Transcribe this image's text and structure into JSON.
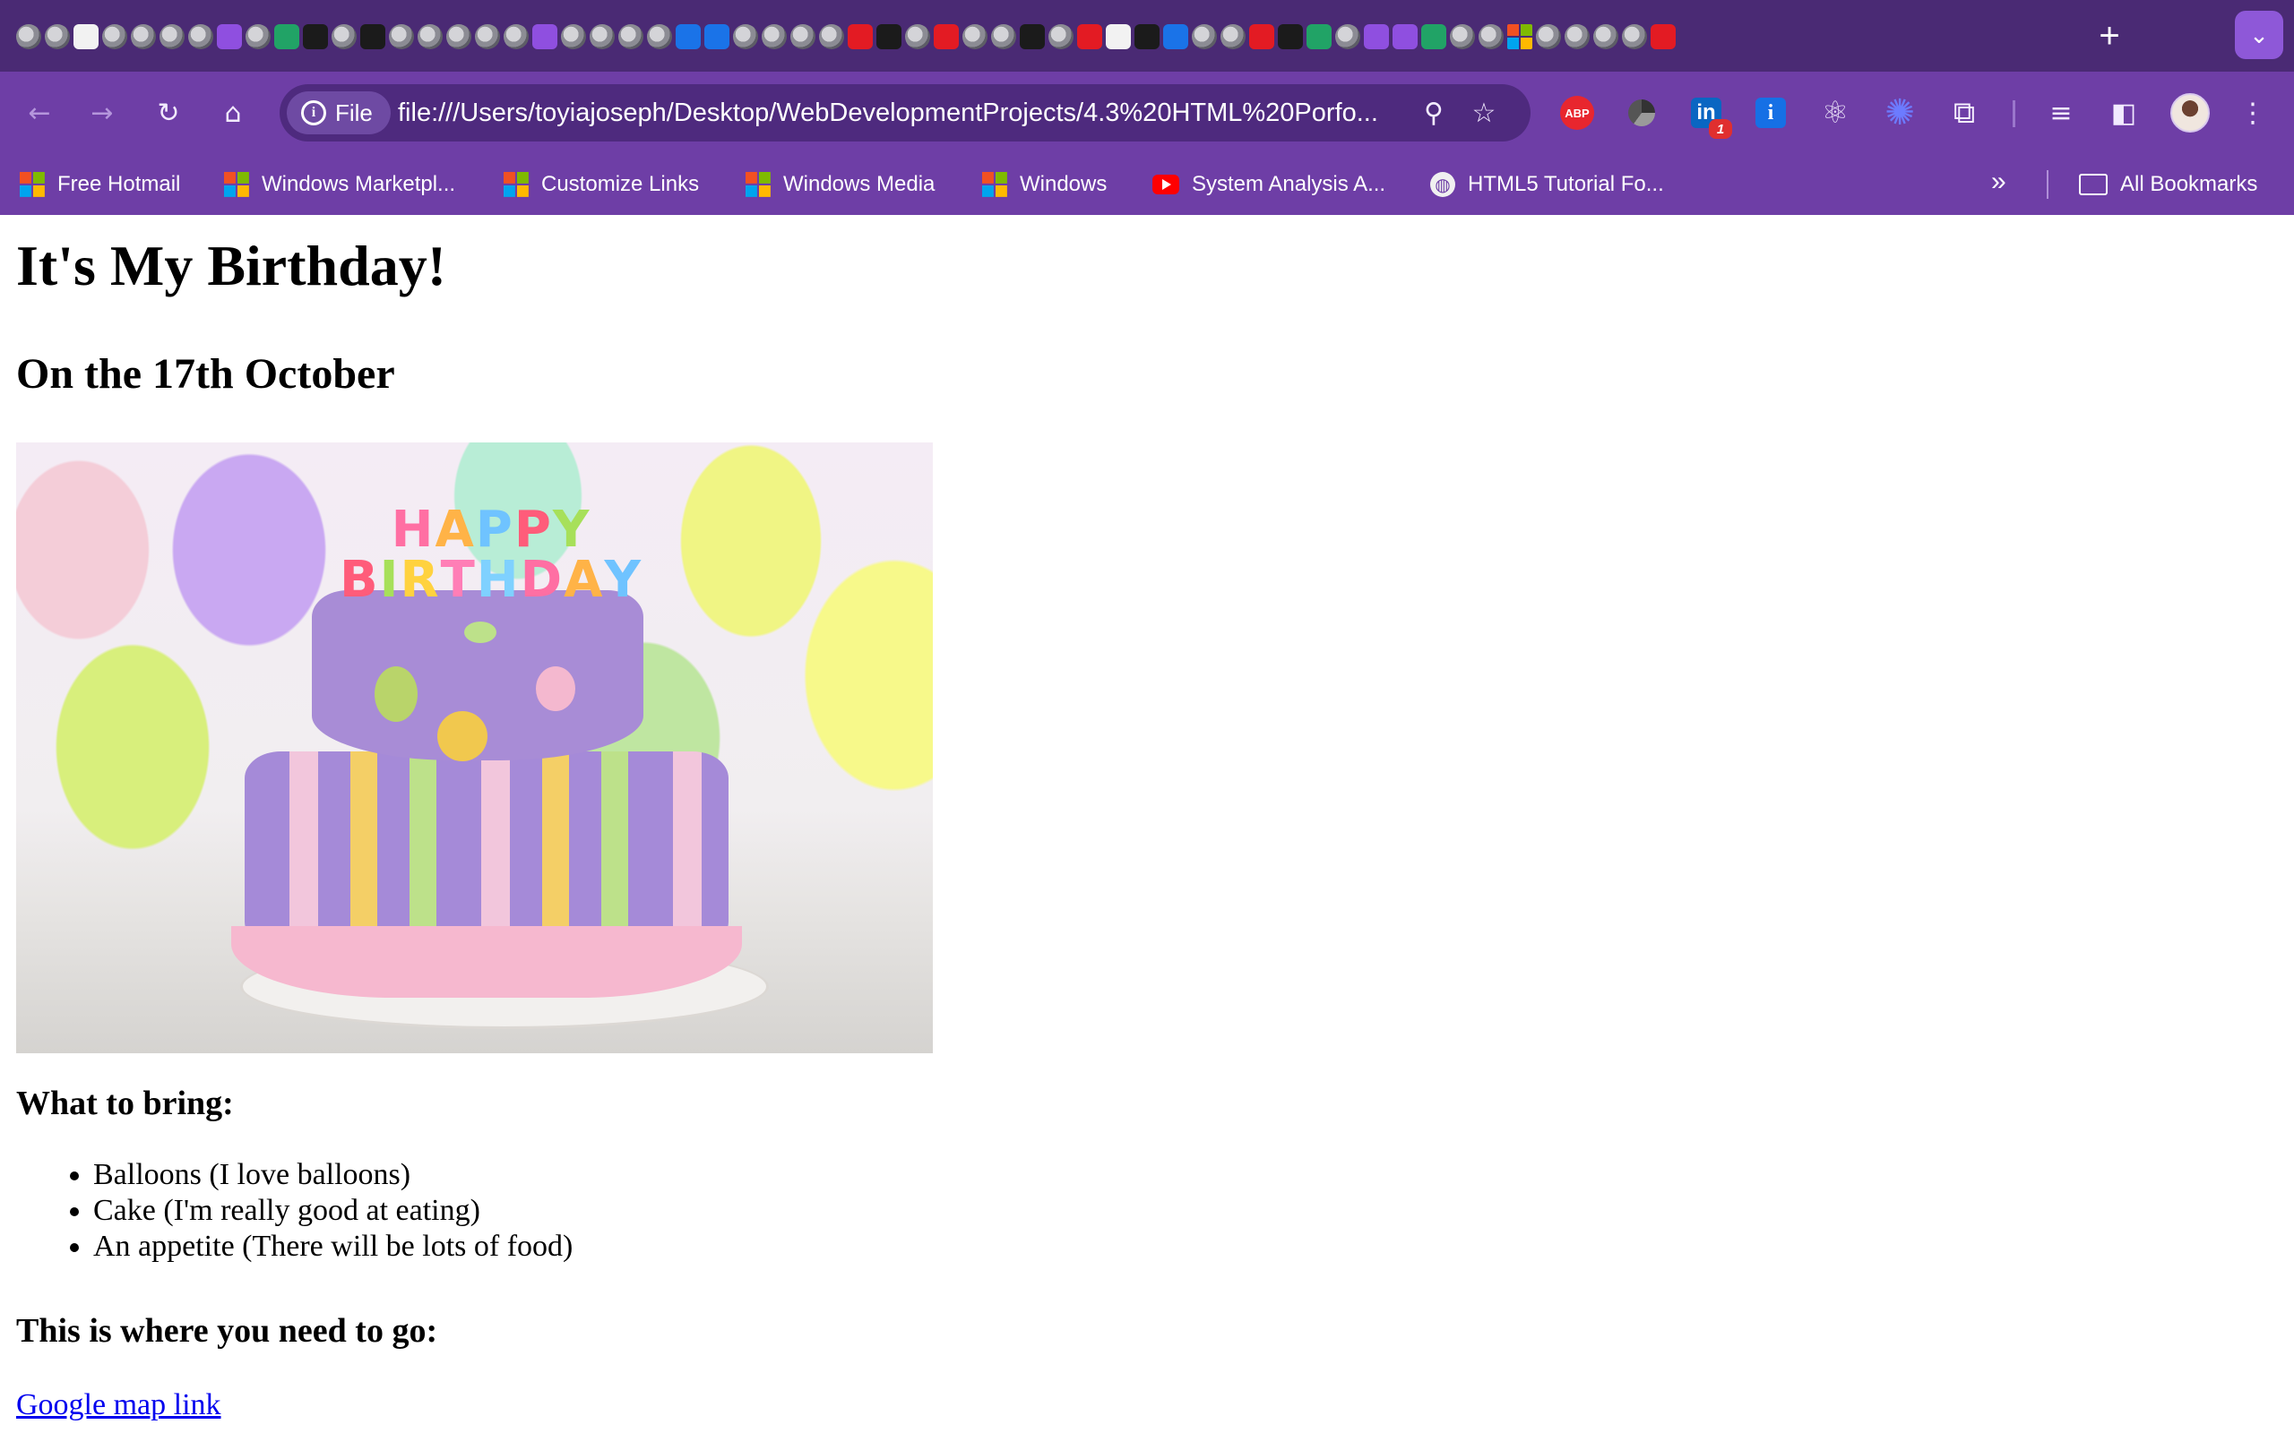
{
  "browser": {
    "tabs": {
      "new_tab_label": "+",
      "tab_search_label": "⌄"
    },
    "toolbar": {
      "site_chip_label": "File",
      "url": "file:///Users/toyiajoseph/Desktop/WebDevelopmentProjects/4.3%20HTML%20Porfo...",
      "extensions": {
        "abp_label": "ABP",
        "linkedin_label": "in",
        "linkedin_badge": "1",
        "info_label": "i"
      }
    },
    "bookmarks": {
      "items": [
        {
          "label": "Free Hotmail",
          "icon": "microsoft-icon"
        },
        {
          "label": "Windows Marketpl...",
          "icon": "microsoft-icon"
        },
        {
          "label": "Customize Links",
          "icon": "microsoft-icon"
        },
        {
          "label": "Windows Media",
          "icon": "microsoft-icon"
        },
        {
          "label": "Windows",
          "icon": "microsoft-icon"
        },
        {
          "label": "System Analysis A...",
          "icon": "youtube-icon"
        },
        {
          "label": "HTML5 Tutorial Fo...",
          "icon": "globe-icon"
        }
      ],
      "overflow_label": "»",
      "all_bookmarks_label": "All Bookmarks"
    }
  },
  "page": {
    "title": "It's My Birthday!",
    "date": "On the 17th October",
    "image": {
      "letters_row1": [
        "H",
        "A",
        "P",
        "P",
        "Y"
      ],
      "letters_row2": [
        "B",
        "I",
        "R",
        "T",
        "H",
        "D",
        "A",
        "Y"
      ],
      "letter_colors": [
        "#ff6fa3",
        "#ffb347",
        "#6fc3ff",
        "#ff5c7a",
        "#a7e05a",
        "#ffd23f",
        "#ff7eb6",
        "#7fd1ff"
      ]
    },
    "bring_heading": "What to bring:",
    "bring_items": [
      "Balloons (I love balloons)",
      "Cake (I'm really good at eating)",
      "An appetite (There will be lots of food)"
    ],
    "go_heading": "This is where you need to go:",
    "map_link": "Google map link"
  },
  "colors": {
    "tabstrip_bg": "#4a2a74",
    "toolbar_bg": "#6e3ea6",
    "omnibox_bg": "#4e2a7e",
    "link": "#0000ee"
  }
}
